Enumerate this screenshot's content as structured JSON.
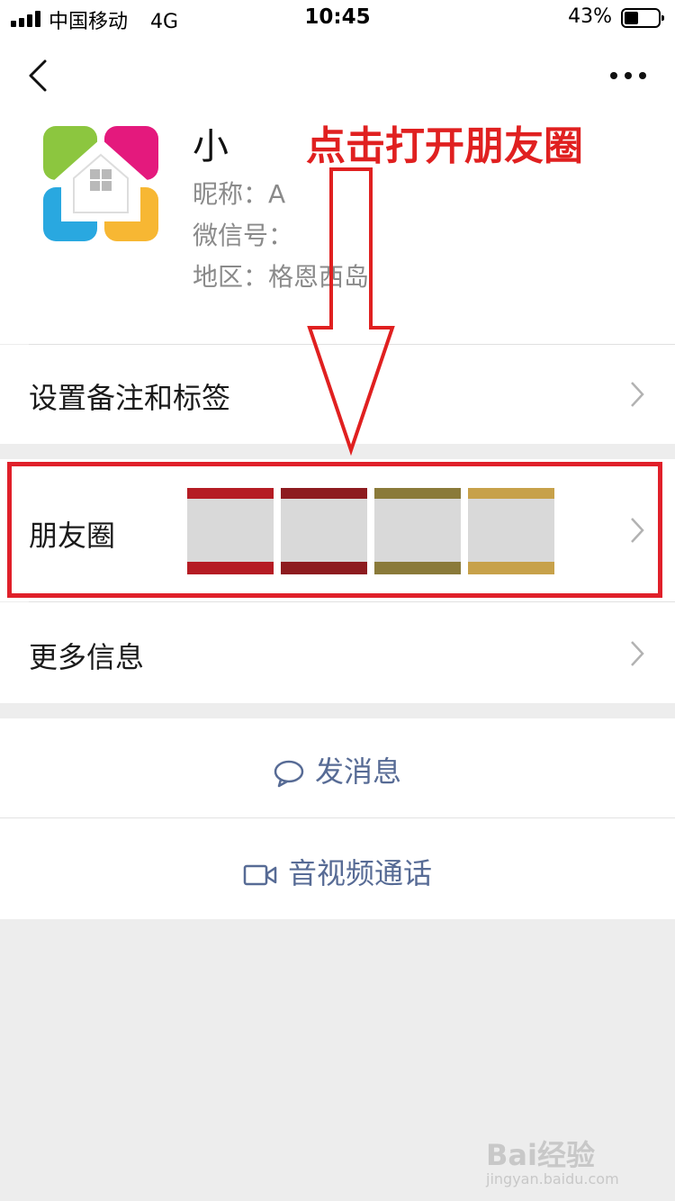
{
  "status_bar": {
    "carrier": "中国移动",
    "network": "4G",
    "time": "10:45",
    "battery_percent": "43%",
    "battery_level": 0.43
  },
  "nav": {
    "back_icon": "chevron-left-icon",
    "more_icon": "ellipsis-icon"
  },
  "profile": {
    "name": "小",
    "nickname_label": "昵称：",
    "nickname_value": "A",
    "wechat_id_label": "微信号：",
    "wechat_id_value": "",
    "region_label": "地区：",
    "region_value": "格恩西岛"
  },
  "annotation": {
    "text": "点击打开朋友圈",
    "color": "#e02020"
  },
  "rows": {
    "remark": "设置备注和标签",
    "moments": "朋友圈",
    "more_info": "更多信息"
  },
  "actions": {
    "message": "发消息",
    "video_call": "音视频通话"
  },
  "watermark": {
    "brand": "Bai经验",
    "url": "jingyan.baidu.com"
  },
  "colors": {
    "link": "#576b95",
    "highlight": "#e0202a",
    "background": "#ededed"
  }
}
